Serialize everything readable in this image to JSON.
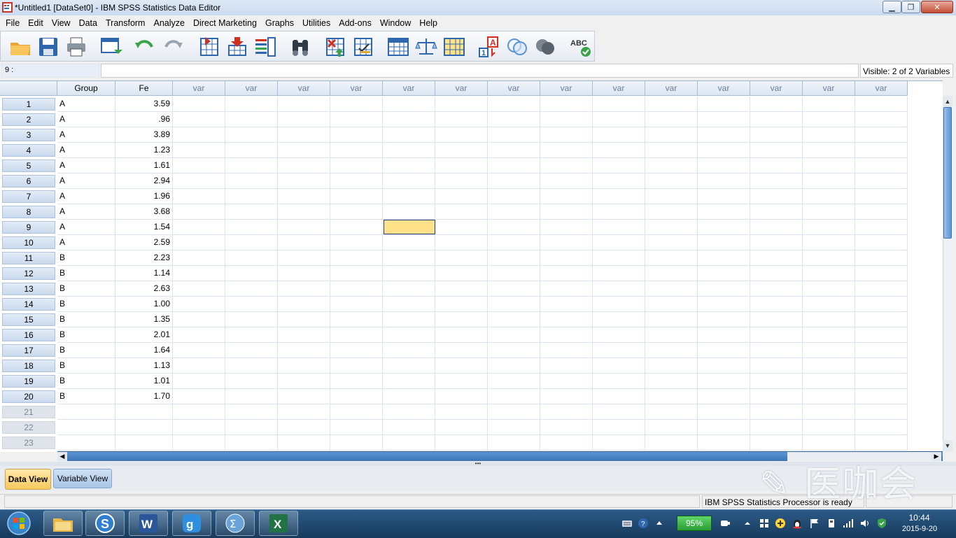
{
  "window": {
    "title": "*Untitled1 [DataSet0] - IBM SPSS Statistics Data Editor",
    "minimize_glyph": "▁",
    "maximize_glyph": "❐",
    "close_glyph": "✕"
  },
  "menu": [
    "File",
    "Edit",
    "View",
    "Data",
    "Transform",
    "Analyze",
    "Direct Marketing",
    "Graphs",
    "Utilities",
    "Add-ons",
    "Window",
    "Help"
  ],
  "toolbar": {
    "tools": [
      "open-icon",
      "save-icon",
      "print-icon",
      "dialog-recall-icon",
      "undo-icon",
      "redo-icon",
      "goto-case-icon",
      "goto-variable-icon",
      "variables-icon",
      "find-icon",
      "insert-cases-icon",
      "insert-variable-icon",
      "split-file-icon",
      "weight-cases-icon",
      "select-cases-icon",
      "value-labels-icon",
      "use-variable-sets-icon",
      "show-all-variables-icon",
      "spell-check-icon"
    ]
  },
  "cell_ref": "9 :",
  "visible_label": "Visible: 2 of 2 Variables",
  "columns": [
    "Group",
    "Fe",
    "var",
    "var",
    "var",
    "var",
    "var",
    "var",
    "var",
    "var",
    "var",
    "var",
    "var",
    "var",
    "var",
    "var"
  ],
  "rows": [
    {
      "n": "1",
      "group": "A",
      "fe": "3.59"
    },
    {
      "n": "2",
      "group": "A",
      "fe": ".96"
    },
    {
      "n": "3",
      "group": "A",
      "fe": "3.89"
    },
    {
      "n": "4",
      "group": "A",
      "fe": "1.23"
    },
    {
      "n": "5",
      "group": "A",
      "fe": "1.61"
    },
    {
      "n": "6",
      "group": "A",
      "fe": "2.94"
    },
    {
      "n": "7",
      "group": "A",
      "fe": "1.96"
    },
    {
      "n": "8",
      "group": "A",
      "fe": "3.68"
    },
    {
      "n": "9",
      "group": "A",
      "fe": "1.54"
    },
    {
      "n": "10",
      "group": "A",
      "fe": "2.59"
    },
    {
      "n": "11",
      "group": "B",
      "fe": "2.23"
    },
    {
      "n": "12",
      "group": "B",
      "fe": "1.14"
    },
    {
      "n": "13",
      "group": "B",
      "fe": "2.63"
    },
    {
      "n": "14",
      "group": "B",
      "fe": "1.00"
    },
    {
      "n": "15",
      "group": "B",
      "fe": "1.35"
    },
    {
      "n": "16",
      "group": "B",
      "fe": "2.01"
    },
    {
      "n": "17",
      "group": "B",
      "fe": "1.64"
    },
    {
      "n": "18",
      "group": "B",
      "fe": "1.13"
    },
    {
      "n": "19",
      "group": "B",
      "fe": "1.01"
    },
    {
      "n": "20",
      "group": "B",
      "fe": "1.70"
    }
  ],
  "empty_rows": [
    "21",
    "22",
    "23"
  ],
  "selected_cell": {
    "row": "9",
    "column": "var"
  },
  "tabs": {
    "data_view": "Data View",
    "variable_view": "Variable View"
  },
  "status": {
    "text": "IBM SPSS Statistics Processor is ready"
  },
  "watermark": "医咖会",
  "taskbar": {
    "apps": [
      "explorer-icon",
      "sogou-icon",
      "word-icon",
      "qq-browser-icon",
      "sigma-icon",
      "excel-icon"
    ],
    "battery": "95%",
    "time": "10:44",
    "date": "2015-9-20"
  },
  "colors": {
    "selected_cell": "#fde28a",
    "data_view_tab": "#f6c95e",
    "scroll_thumb": "#5d94d2",
    "taskbar": "#1f4a73"
  }
}
